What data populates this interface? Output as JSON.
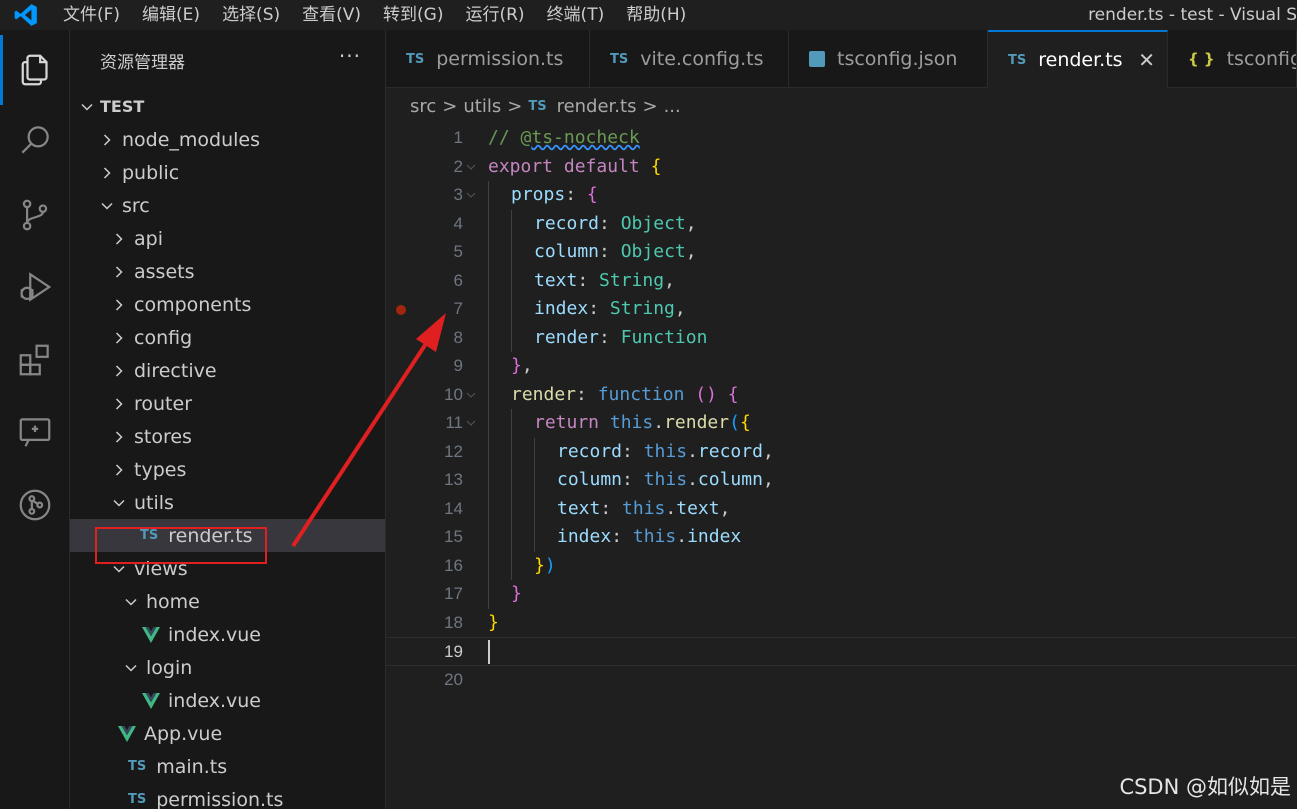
{
  "window": {
    "title": "render.ts - test - Visual S"
  },
  "menu": [
    "文件(F)",
    "编辑(E)",
    "选择(S)",
    "查看(V)",
    "转到(G)",
    "运行(R)",
    "终端(T)",
    "帮助(H)"
  ],
  "activity_bar": [
    "explorer-icon",
    "search-icon",
    "source-control-icon",
    "run-debug-icon",
    "extensions-icon",
    "remote-explorer-icon",
    "git-graph-icon"
  ],
  "sidebar": {
    "title": "资源管理器",
    "more": "···",
    "folder": "TEST",
    "tree": [
      {
        "label": "node_modules",
        "type": "folder",
        "depth": 0,
        "expanded": false
      },
      {
        "label": "public",
        "type": "folder",
        "depth": 0,
        "expanded": false
      },
      {
        "label": "src",
        "type": "folder",
        "depth": 0,
        "expanded": true
      },
      {
        "label": "api",
        "type": "folder",
        "depth": 1,
        "expanded": false
      },
      {
        "label": "assets",
        "type": "folder",
        "depth": 1,
        "expanded": false
      },
      {
        "label": "components",
        "type": "folder",
        "depth": 1,
        "expanded": false
      },
      {
        "label": "config",
        "type": "folder",
        "depth": 1,
        "expanded": false
      },
      {
        "label": "directive",
        "type": "folder",
        "depth": 1,
        "expanded": false
      },
      {
        "label": "router",
        "type": "folder",
        "depth": 1,
        "expanded": false
      },
      {
        "label": "stores",
        "type": "folder",
        "depth": 1,
        "expanded": false
      },
      {
        "label": "types",
        "type": "folder",
        "depth": 1,
        "expanded": false
      },
      {
        "label": "utils",
        "type": "folder",
        "depth": 1,
        "expanded": true
      },
      {
        "label": "render.ts",
        "type": "ts",
        "depth": 2,
        "selected": true
      },
      {
        "label": "views",
        "type": "folder",
        "depth": 1,
        "expanded": true
      },
      {
        "label": "home",
        "type": "folder",
        "depth": 2,
        "expanded": true
      },
      {
        "label": "index.vue",
        "type": "vue",
        "depth": 3
      },
      {
        "label": "login",
        "type": "folder",
        "depth": 2,
        "expanded": true
      },
      {
        "label": "index.vue",
        "type": "vue",
        "depth": 3
      },
      {
        "label": "App.vue",
        "type": "vue",
        "depth": 1
      },
      {
        "label": "main.ts",
        "type": "ts",
        "depth": 1
      },
      {
        "label": "permission.ts",
        "type": "ts",
        "depth": 1
      }
    ]
  },
  "badges": {
    "ts": "TS",
    "json": "{ }"
  },
  "tabs": [
    {
      "label": "permission.ts",
      "type": "ts",
      "active": false
    },
    {
      "label": "vite.config.ts",
      "type": "ts",
      "active": false
    },
    {
      "label": "tsconfig.json",
      "type": "tsjson",
      "active": false
    },
    {
      "label": "render.ts",
      "type": "ts",
      "active": true,
      "close": "✕"
    },
    {
      "label": "tsconfig.a",
      "type": "json",
      "active": false
    }
  ],
  "breadcrumb": {
    "parts": [
      "src",
      "utils",
      "render.ts",
      "..."
    ],
    "separator": ">"
  },
  "editor": {
    "current_line": 19,
    "breakpoint_line": 7,
    "lines": [
      {
        "n": "1",
        "indent": 0,
        "tokens": [
          [
            "cmt",
            "// @"
          ],
          [
            "cmt squiggle",
            "ts-nocheck"
          ]
        ]
      },
      {
        "n": "2",
        "indent": 0,
        "fold": true,
        "tokens": [
          [
            "kw-ctrl",
            "export"
          ],
          [
            "punc",
            " "
          ],
          [
            "kw-ctrl",
            "default"
          ],
          [
            "punc",
            " "
          ],
          [
            "b1",
            "{"
          ]
        ]
      },
      {
        "n": "3",
        "indent": 1,
        "fold": true,
        "tokens": [
          [
            "prop",
            "props"
          ],
          [
            "punc",
            ": "
          ],
          [
            "b2",
            "{"
          ]
        ]
      },
      {
        "n": "4",
        "indent": 2,
        "tokens": [
          [
            "prop",
            "record"
          ],
          [
            "punc",
            ": "
          ],
          [
            "type",
            "Object"
          ],
          [
            "punc",
            ","
          ]
        ]
      },
      {
        "n": "5",
        "indent": 2,
        "tokens": [
          [
            "prop",
            "column"
          ],
          [
            "punc",
            ": "
          ],
          [
            "type",
            "Object"
          ],
          [
            "punc",
            ","
          ]
        ]
      },
      {
        "n": "6",
        "indent": 2,
        "tokens": [
          [
            "prop",
            "text"
          ],
          [
            "punc",
            ": "
          ],
          [
            "type",
            "String"
          ],
          [
            "punc",
            ","
          ]
        ]
      },
      {
        "n": "7",
        "indent": 2,
        "tokens": [
          [
            "prop",
            "index"
          ],
          [
            "punc",
            ": "
          ],
          [
            "type",
            "String"
          ],
          [
            "punc",
            ","
          ]
        ]
      },
      {
        "n": "8",
        "indent": 2,
        "tokens": [
          [
            "prop",
            "render"
          ],
          [
            "punc",
            ": "
          ],
          [
            "type",
            "Function"
          ]
        ]
      },
      {
        "n": "9",
        "indent": 1,
        "tokens": [
          [
            "b2",
            "}"
          ],
          [
            "punc",
            ","
          ]
        ]
      },
      {
        "n": "10",
        "indent": 1,
        "fold": true,
        "tokens": [
          [
            "fn",
            "render"
          ],
          [
            "punc",
            ": "
          ],
          [
            "kw",
            "function"
          ],
          [
            "punc",
            " "
          ],
          [
            "b2",
            "()"
          ],
          [
            "punc",
            " "
          ],
          [
            "b2",
            "{"
          ]
        ]
      },
      {
        "n": "11",
        "indent": 2,
        "fold": true,
        "tokens": [
          [
            "kw-ctrl",
            "return"
          ],
          [
            "punc",
            " "
          ],
          [
            "kw",
            "this"
          ],
          [
            "punc",
            "."
          ],
          [
            "fn",
            "render"
          ],
          [
            "b3",
            "("
          ],
          [
            "b1",
            "{"
          ]
        ]
      },
      {
        "n": "12",
        "indent": 3,
        "tokens": [
          [
            "prop",
            "record"
          ],
          [
            "punc",
            ": "
          ],
          [
            "kw",
            "this"
          ],
          [
            "punc",
            "."
          ],
          [
            "prop",
            "record"
          ],
          [
            "punc",
            ","
          ]
        ]
      },
      {
        "n": "13",
        "indent": 3,
        "tokens": [
          [
            "prop",
            "column"
          ],
          [
            "punc",
            ": "
          ],
          [
            "kw",
            "this"
          ],
          [
            "punc",
            "."
          ],
          [
            "prop",
            "column"
          ],
          [
            "punc",
            ","
          ]
        ]
      },
      {
        "n": "14",
        "indent": 3,
        "tokens": [
          [
            "prop",
            "text"
          ],
          [
            "punc",
            ": "
          ],
          [
            "kw",
            "this"
          ],
          [
            "punc",
            "."
          ],
          [
            "prop",
            "text"
          ],
          [
            "punc",
            ","
          ]
        ]
      },
      {
        "n": "15",
        "indent": 3,
        "tokens": [
          [
            "prop",
            "index"
          ],
          [
            "punc",
            ": "
          ],
          [
            "kw",
            "this"
          ],
          [
            "punc",
            "."
          ],
          [
            "prop",
            "index"
          ]
        ]
      },
      {
        "n": "16",
        "indent": 2,
        "tokens": [
          [
            "b1",
            "}"
          ],
          [
            "b3",
            ")"
          ]
        ]
      },
      {
        "n": "17",
        "indent": 1,
        "tokens": [
          [
            "b2",
            "}"
          ]
        ]
      },
      {
        "n": "18",
        "indent": 0,
        "tokens": [
          [
            "b1",
            "}"
          ]
        ]
      },
      {
        "n": "19",
        "indent": 0,
        "tokens": []
      },
      {
        "n": "20",
        "indent": 0,
        "tokens": []
      }
    ]
  },
  "watermark": "CSDN @如似如是",
  "colors": {
    "accent": "#0078d4",
    "annotation_red": "#e02020",
    "ts_blue": "#519aba",
    "vue_green": "#41b883"
  }
}
